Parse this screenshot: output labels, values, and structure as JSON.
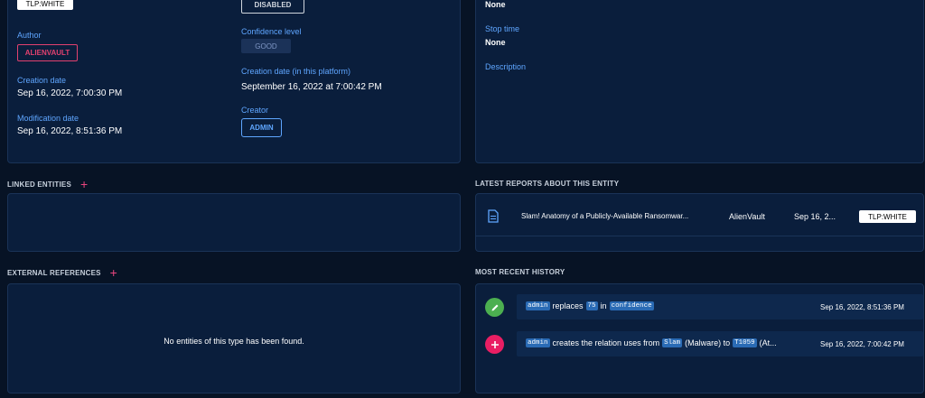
{
  "left_card": {
    "tlp_marking": "TLP:WHITE",
    "author_label": "Author",
    "author_value": "ALIENVAULT",
    "creation_date_label": "Creation date",
    "creation_date_value": "Sep 16, 2022, 7:00:30 PM",
    "modification_date_label": "Modification date",
    "modification_date_value": "Sep 16, 2022, 8:51:36 PM",
    "status_value": "DISABLED",
    "confidence_label": "Confidence level",
    "confidence_value": "GOOD",
    "platform_creation_label": "Creation date (in this platform)",
    "platform_creation_value": "September 16, 2022 at 7:00:42 PM",
    "creator_label": "Creator",
    "creator_value": "ADMIN"
  },
  "right_card": {
    "start_time_value": "None",
    "stop_time_label": "Stop time",
    "stop_time_value": "None",
    "description_label": "Description"
  },
  "linked_entities": {
    "title": "LINKED ENTITIES",
    "add": "+"
  },
  "external_references": {
    "title": "EXTERNAL REFERENCES",
    "add": "+",
    "empty_message": "No entities of this type has been found."
  },
  "latest_reports": {
    "title": "LATEST REPORTS ABOUT THIS ENTITY",
    "items": [
      {
        "title": "Slam! Anatomy of a Publicly-Available Ransomwar...",
        "author": "AlienVault",
        "date": "Sep 16, 2...",
        "marking": "TLP:WHITE",
        "icon": "document-icon"
      }
    ]
  },
  "recent_history": {
    "title": "MOST RECENT HISTORY",
    "items": [
      {
        "icon": "pencil-icon",
        "color": "#4caf50",
        "user": "admin",
        "verb": "replaces",
        "value": "75",
        "prep": "in",
        "field": "confidence",
        "date": "Sep 16, 2022, 8:51:36 PM"
      },
      {
        "icon": "plus-icon",
        "color": "#e91e63",
        "user": "admin",
        "verb": "creates the relation uses from",
        "source": "Slam",
        "source_type": "(Malware) to",
        "target": "T1059",
        "target_type": "(At...",
        "date": "Sep 16, 2022, 7:00:42 PM"
      }
    ]
  },
  "colors": {
    "background": "#071325",
    "panel": "#0a1e3c",
    "accent_blue": "#5fa6ff",
    "accent_pink": "#e2416f"
  }
}
